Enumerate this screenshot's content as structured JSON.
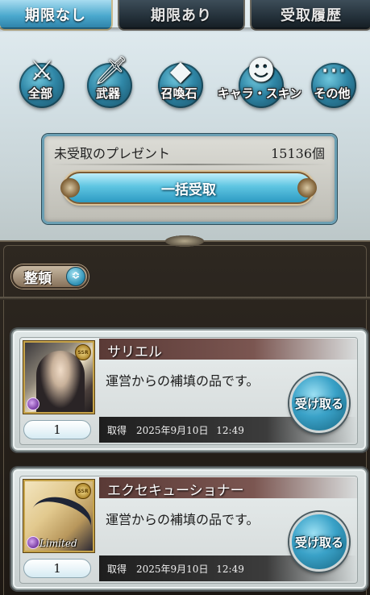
{
  "tabs": [
    {
      "label": "期限なし",
      "active": true
    },
    {
      "label": "期限あり",
      "active": false
    },
    {
      "label": "受取履歴",
      "active": false
    }
  ],
  "categories": [
    {
      "label": "全部",
      "icon": "all-items-icon"
    },
    {
      "label": "武器",
      "icon": "weapon-icon"
    },
    {
      "label": "召喚石",
      "icon": "summon-stone-icon"
    },
    {
      "label": "キャラ・スキン",
      "icon": "character-skin-icon"
    },
    {
      "label": "その他",
      "icon": "other-icon"
    }
  ],
  "summary": {
    "label": "未受取のプレゼント",
    "count": "15136個",
    "bulk_button": "一括受取"
  },
  "sort": {
    "label": "整頓",
    "icon": "sort-toggle-icon"
  },
  "items": [
    {
      "name": "サリエル",
      "description": "運営からの補填の品です。",
      "quantity": "1",
      "received": "取得　2025年9月10日 12:49",
      "rarity": "SSR",
      "limited": "",
      "button": "受け取る"
    },
    {
      "name": "エクセキューショナー",
      "description": "運営からの補填の品です。",
      "quantity": "1",
      "received": "取得　2025年9月10日 12:49",
      "rarity": "SSR",
      "limited": "Limited",
      "button": "受け取る"
    }
  ],
  "colors": {
    "accent_tab": "#4aa8cd",
    "receive_button": "#3aa2c8",
    "panel_bg": "#1d1813"
  }
}
